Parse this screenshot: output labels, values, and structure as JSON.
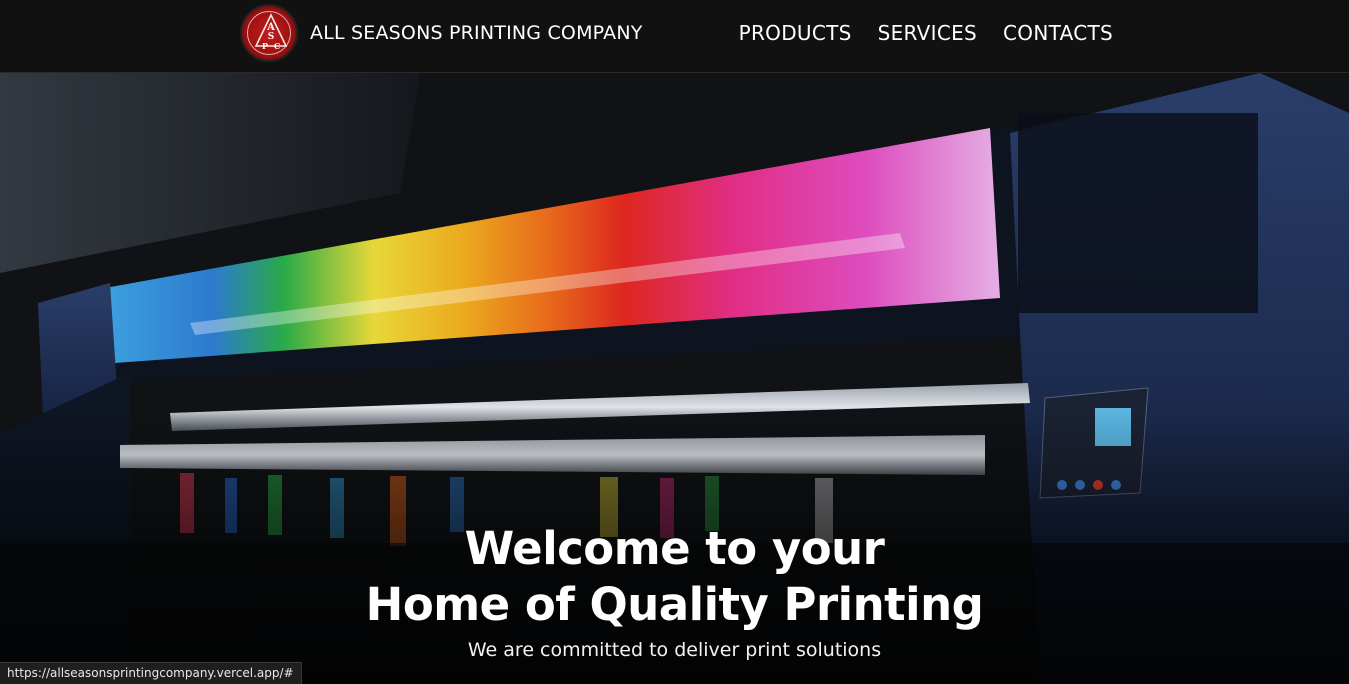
{
  "navbar": {
    "logo_letters": [
      "A",
      "S",
      "P",
      "C"
    ],
    "brand_name": "ALL SEASONS PRINTING COMPANY",
    "links": [
      {
        "label": "PRODUCTS"
      },
      {
        "label": "SERVICES"
      },
      {
        "label": "CONTACTS"
      }
    ]
  },
  "hero": {
    "title_line1": "Welcome to your",
    "title_line2": "Home of Quality Printing",
    "subtitle": "We are committed to deliver print solutions"
  },
  "status_bar": {
    "url": "https://allseasonsprintingcompany.vercel.app/#"
  },
  "colors": {
    "navbar_bg": "#111111",
    "logo_red": "#c41c1c",
    "text": "#ffffff"
  }
}
